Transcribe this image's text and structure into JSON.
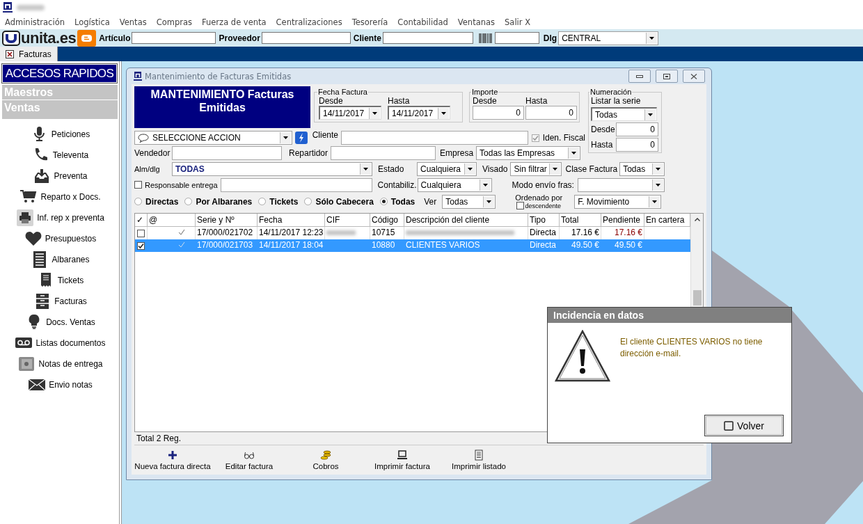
{
  "menu": [
    "Administración",
    "Logística",
    "Ventas",
    "Compras",
    "Fuerza de venta",
    "Centralizaciones",
    "Tesorería",
    "Contabilidad",
    "Ventanas",
    "Salir X"
  ],
  "toolbar": {
    "logo": "unita.es",
    "fields": [
      {
        "label": "Artículo"
      },
      {
        "label": "Proveedor"
      },
      {
        "label": "Cliente"
      }
    ],
    "dlg": {
      "label": "Dlg",
      "value": "CENTRAL"
    }
  },
  "tabs": [
    {
      "label": "Facturas",
      "selected": true
    }
  ],
  "sidebar": {
    "title": "ACCESOS RAPIDOS",
    "sections": [
      {
        "label": "Maestros",
        "expanded": false
      },
      {
        "label": "Ventas",
        "expanded": true,
        "items": [
          {
            "label": "Peticiones",
            "kind": "microphone"
          },
          {
            "label": "Televenta",
            "kind": "phone"
          },
          {
            "label": "Preventa",
            "kind": "inbox"
          },
          {
            "label": "Reparto x Docs.",
            "kind": "cart"
          },
          {
            "label": "Inf. rep x preventa",
            "kind": "printer"
          },
          {
            "label": "Presupuestos",
            "kind": "heart"
          },
          {
            "label": "Albaranes",
            "kind": "list"
          },
          {
            "label": "Tickets",
            "kind": "receipt"
          },
          {
            "label": "Facturas",
            "kind": "cabinet"
          },
          {
            "label": "Docs. Ventas",
            "kind": "bulb"
          },
          {
            "label": "Listas documentos",
            "kind": "tape"
          },
          {
            "label": "Notas de entrega",
            "kind": "safe"
          },
          {
            "label": "Envio notas",
            "kind": "envelope"
          }
        ]
      }
    ]
  },
  "window": {
    "title": "Mantenimiento de Facturas Emitidas",
    "heading": "MANTENIMIENTO Facturas Emitidas",
    "fecha": {
      "legend": "Fecha Factura",
      "desde": {
        "label": "Desde",
        "value": "14/11/2017"
      },
      "hasta": {
        "label": "Hasta",
        "value": "14/11/2017"
      }
    },
    "importe": {
      "legend": "Importe",
      "desde": {
        "label": "Desde",
        "value": "0"
      },
      "hasta": {
        "label": "Hasta",
        "value": "0"
      }
    },
    "numeracion": {
      "legend": "Numeración",
      "serie_label": "Listar la serie",
      "serie": "Todas",
      "desde": {
        "label": "Desde",
        "value": "0"
      },
      "hasta": {
        "label": "Hasta",
        "value": "0"
      }
    },
    "accion": "SELECCIONE ACCION",
    "cliente_label": "Cliente",
    "iden_fiscal": {
      "label": "Iden. Fiscal",
      "checked": true,
      "disabled": true
    },
    "vendedor_label": "Vendedor",
    "repartidor_label": "Repartidor",
    "empresa": {
      "label": "Empresa",
      "value": "Todas las Empresas"
    },
    "alm_dlg": {
      "label": "Alm/dlg",
      "value": "TODAS"
    },
    "estado": {
      "label": "Estado",
      "value": "Cualquiera"
    },
    "visado": {
      "label": "Visado",
      "value": "Sin filtrar"
    },
    "clase_factura": {
      "label": "Clase Factura",
      "value": "Todas"
    },
    "responsable": {
      "label": "Responsable entrega",
      "checked": false
    },
    "contabiliz": {
      "label": "Contabiliz.",
      "value": "Cualquiera"
    },
    "modo_envio": {
      "label": "Modo envío fras:"
    },
    "radios": [
      {
        "label": "Directas",
        "selected": false
      },
      {
        "label": "Por Albaranes",
        "selected": false
      },
      {
        "label": "Tickets",
        "selected": false
      },
      {
        "label": "Sólo Cabecera",
        "selected": false
      },
      {
        "label": "Todas",
        "selected": true
      }
    ],
    "ver": {
      "label": "Ver",
      "value": "Todas"
    },
    "ordenado": {
      "label": "Ordenado por",
      "descendente": {
        "label": "descendente",
        "checked": false
      },
      "value": "F. Movimiento"
    },
    "table": {
      "columns": [
        "✓",
        "@",
        "Serie y Nº",
        "Fecha",
        "CIF",
        "Código",
        "Descripción del cliente",
        "Tipo",
        "Total",
        "Pendiente",
        "En cartera"
      ],
      "rows": [
        {
          "checked": false,
          "selected": false,
          "mailed": true,
          "redacted": true,
          "serie": "17/000/021702",
          "fecha": "14/11/2017 12:23",
          "codigo": "10715",
          "tipo": "Directa",
          "total": "17.16 €",
          "pendiente": "17.16 €"
        },
        {
          "checked": true,
          "selected": true,
          "mailed": true,
          "redacted": false,
          "serie": "17/000/021703",
          "fecha": "14/11/2017 18:04",
          "codigo": "10880",
          "cliente": "CLIENTES VARIOS",
          "tipo": "Directa",
          "total": "49.50 €",
          "pendiente": "49.50 €"
        }
      ]
    },
    "status": "Total 2 Reg.",
    "actions": [
      {
        "label": "Nueva factura directa",
        "kind": "plus"
      },
      {
        "label": "Editar factura",
        "kind": "glasses"
      },
      {
        "label": "Cobros",
        "kind": "coins"
      },
      {
        "label": "Imprimir factura",
        "kind": "laptop"
      },
      {
        "label": "Imprimir listado",
        "kind": "sheet"
      }
    ]
  },
  "dialog": {
    "title": "Incidencia en datos",
    "message": "El cliente CLIENTES VARIOS no tiene dirección e-mail.",
    "button": "Volver"
  }
}
